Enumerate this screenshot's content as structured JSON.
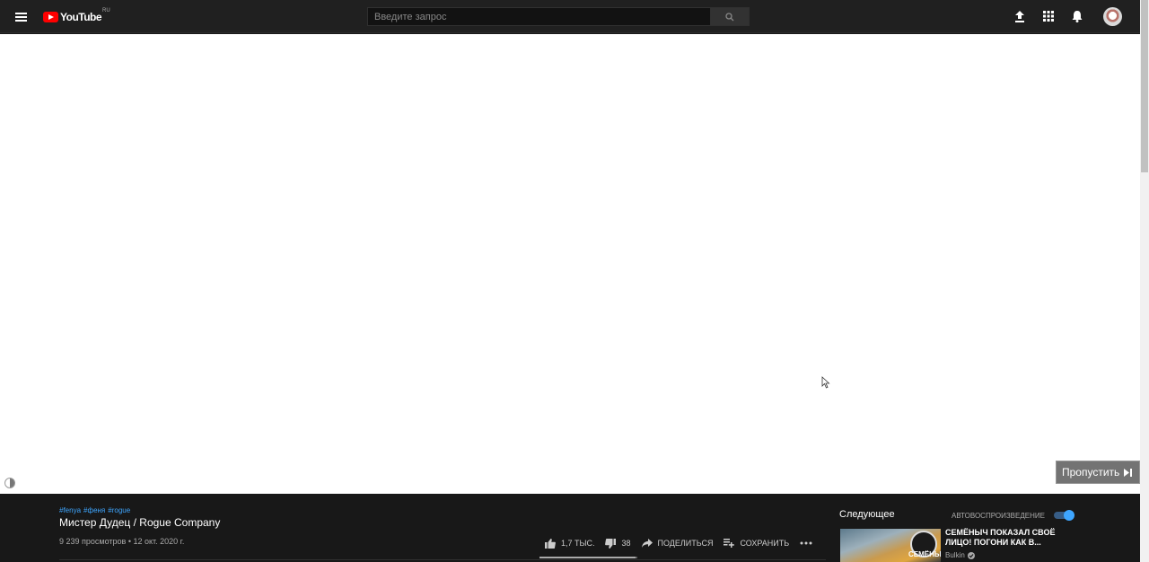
{
  "header": {
    "logo_text": "YouTube",
    "logo_region": "RU",
    "search_placeholder": "Введите запрос",
    "icons": [
      "menu-icon",
      "search-icon",
      "upload-icon",
      "apps-icon",
      "notifications-icon",
      "avatar"
    ]
  },
  "player": {
    "skip_label": "Пропустить",
    "skip_icon": "skip-next-icon"
  },
  "video": {
    "hashtags": [
      "#fenya",
      "#феня",
      "#rogue"
    ],
    "title": "Мистер Дудец / Rogue Company",
    "meta": "9 239 просмотров • 12 окт. 2020 г.",
    "likes": "1,7 тыс.",
    "dislikes": "38",
    "share_label": "Поделиться",
    "save_label": "Сохранить"
  },
  "sidebar": {
    "up_next_label": "Следующее",
    "autoplay_label": "Автовоспроизведение",
    "autoplay_on": true,
    "next_video": {
      "title": "СЕМЁНЫЧ ПОКАЗАЛ СВОЁ ЛИЦО! ПОГОНИ КАК В...",
      "channel": "Bulkin",
      "thumb_text": "СЕМЁНЫЧ"
    }
  },
  "colors": {
    "bg": "#181818",
    "header_bg": "#202020",
    "accent_blue": "#3ea6ff",
    "logo_red": "#ff0000"
  }
}
